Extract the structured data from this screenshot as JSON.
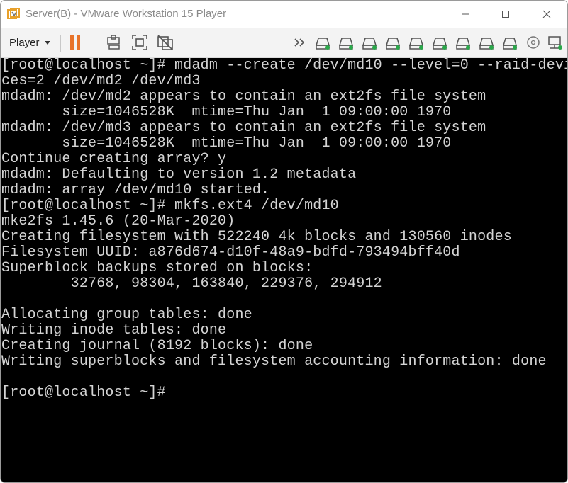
{
  "window": {
    "title": "Server(B) - VMware Workstation 15 Player"
  },
  "toolbar": {
    "player_label": "Player",
    "pause_icon": "pause-icon",
    "send_keys_icon": "send-ctrl-alt-del-icon",
    "fit_guest_icon": "fit-guest-icon",
    "unity_icon": "unity-icon",
    "more_icon": "double-chevron-right-icon",
    "devices": [
      "hdd-icon",
      "hdd-icon",
      "hdd-icon",
      "hdd-icon",
      "hdd-icon",
      "hdd-icon",
      "hdd-icon",
      "hdd-icon",
      "hdd-icon"
    ],
    "cd_icon": "cd-icon",
    "network_icon": "network-icon"
  },
  "colors": {
    "accent_orange": "#e8732a",
    "device_green": "#2aa84a",
    "terminal_bg": "#000000",
    "terminal_fg": "#d4d4d4"
  },
  "terminal": {
    "lines": [
      "[root@localhost ~]# mdadm --create /dev/md10 --level=0 --raid-devi",
      "ces=2 /dev/md2 /dev/md3",
      "mdadm: /dev/md2 appears to contain an ext2fs file system",
      "       size=1046528K  mtime=Thu Jan  1 09:00:00 1970",
      "mdadm: /dev/md3 appears to contain an ext2fs file system",
      "       size=1046528K  mtime=Thu Jan  1 09:00:00 1970",
      "Continue creating array? y",
      "mdadm: Defaulting to version 1.2 metadata",
      "mdadm: array /dev/md10 started.",
      "[root@localhost ~]# mkfs.ext4 /dev/md10",
      "mke2fs 1.45.6 (20-Mar-2020)",
      "Creating filesystem with 522240 4k blocks and 130560 inodes",
      "Filesystem UUID: a876d674-d10f-48a9-bdfd-793494bff40d",
      "Superblock backups stored on blocks:",
      "        32768, 98304, 163840, 229376, 294912",
      "",
      "Allocating group tables: done",
      "Writing inode tables: done",
      "Creating journal (8192 blocks): done",
      "Writing superblocks and filesystem accounting information: done",
      "",
      "[root@localhost ~]#"
    ]
  }
}
